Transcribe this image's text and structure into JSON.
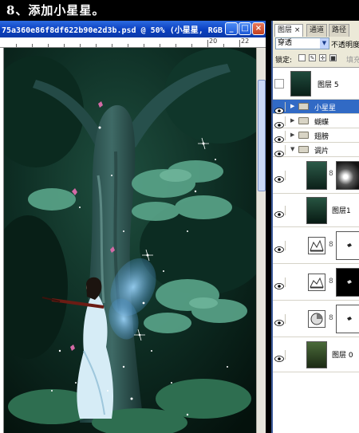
{
  "caption": "8、添加小星星。",
  "document": {
    "title": "75a360e86f8df622b90e2d3b.psd @ 50% (小星星, RGB...",
    "ruler_labels": [
      "20",
      "22"
    ],
    "buttons": {
      "minimize": "_",
      "maximize": "□",
      "close": "×"
    }
  },
  "panel": {
    "tabs": [
      "图层 ×",
      "通道",
      "路径"
    ],
    "blend_mode": "穿透",
    "opacity_label": "不透明度",
    "lock_label": "锁定:",
    "fill_label": "填充",
    "layers": [
      {
        "name": "图层 5",
        "kind": "pixel",
        "visible": false
      },
      {
        "name": "小星星",
        "kind": "group",
        "visible": true,
        "selected": true
      },
      {
        "name": "蝴蝶",
        "kind": "group",
        "visible": true
      },
      {
        "name": "翅膀",
        "kind": "group",
        "visible": true
      },
      {
        "name": "调片",
        "kind": "group",
        "visible": true,
        "expanded": true
      },
      {
        "name": "",
        "kind": "masked",
        "visible": true
      },
      {
        "name": "图层1",
        "kind": "pixel",
        "visible": true
      },
      {
        "name": "",
        "kind": "adjustment",
        "visible": true
      },
      {
        "name": "",
        "kind": "adjustment",
        "visible": true
      },
      {
        "name": "",
        "kind": "adjustment",
        "visible": true
      },
      {
        "name": "图层 0",
        "kind": "pixel",
        "visible": true
      }
    ]
  }
}
